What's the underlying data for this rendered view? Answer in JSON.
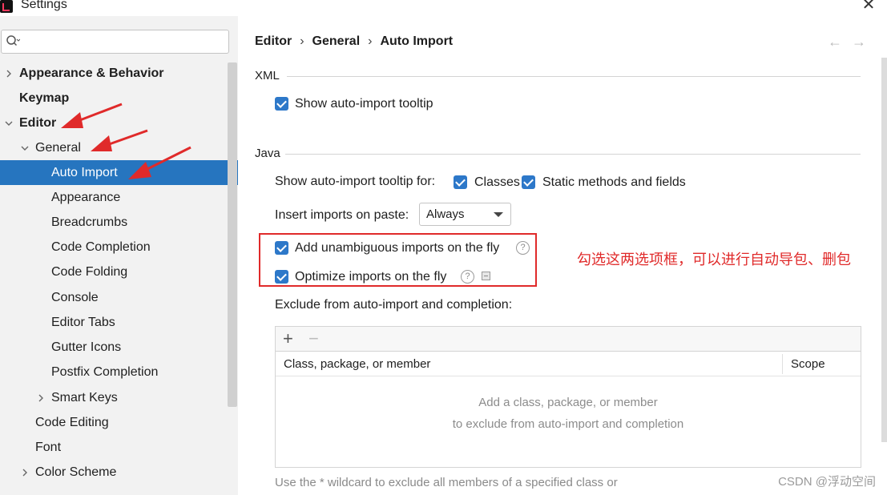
{
  "window": {
    "title": "Settings",
    "close_glyph": "✕",
    "app_icon": "intellij-idea-icon"
  },
  "search": {
    "placeholder": "",
    "value": ""
  },
  "sidebar": {
    "items": [
      {
        "label": "Appearance & Behavior",
        "bold": true,
        "chevron": "right"
      },
      {
        "label": "Keymap",
        "bold": true,
        "chevron": ""
      },
      {
        "label": "Editor",
        "bold": true,
        "chevron": "down"
      },
      {
        "label": "General",
        "bold": false,
        "chevron": "down"
      },
      {
        "label": "Auto Import",
        "bold": false,
        "selected": true
      },
      {
        "label": "Appearance"
      },
      {
        "label": "Breadcrumbs"
      },
      {
        "label": "Code Completion"
      },
      {
        "label": "Code Folding"
      },
      {
        "label": "Console"
      },
      {
        "label": "Editor Tabs"
      },
      {
        "label": "Gutter Icons"
      },
      {
        "label": "Postfix Completion"
      },
      {
        "label": "Smart Keys",
        "chevron": "right"
      },
      {
        "label": "Code Editing"
      },
      {
        "label": "Font"
      },
      {
        "label": "Color Scheme",
        "chevron": "right"
      }
    ]
  },
  "breadcrumb": {
    "items": [
      "Editor",
      "General",
      "Auto Import"
    ],
    "separator": "›"
  },
  "nav": {
    "back": "←",
    "forward": "→"
  },
  "xml": {
    "section": "XML",
    "show_tooltip": {
      "label": "Show auto-import tooltip",
      "checked": true
    }
  },
  "java": {
    "section": "Java",
    "tooltip_for": {
      "label": "Show auto-import tooltip for:",
      "classes": {
        "label": "Classes",
        "checked": true
      },
      "static": {
        "label": "Static methods and fields",
        "checked": true
      }
    },
    "insert_imports": {
      "label": "Insert imports on paste:",
      "value": "Always"
    },
    "add_unambiguous": {
      "label": "Add unambiguous imports on the fly",
      "checked": true
    },
    "optimize": {
      "label": "Optimize imports on the fly",
      "checked": true
    },
    "help_glyph": "?",
    "exclude": {
      "label": "Exclude from auto-import and completion:",
      "add_glyph": "+",
      "remove_glyph": "−",
      "columns": [
        "Class, package, or member",
        "Scope"
      ],
      "empty_line1": "Add a class, package, or member",
      "empty_line2": "to exclude from auto-import and completion"
    },
    "footnote": "Use the * wildcard to exclude all members of a specified class or"
  },
  "annotation": {
    "text": "勾选这两选项框，可以进行自动导包、删包",
    "color": "#e02a2a"
  },
  "watermark": "CSDN @浮动空间",
  "colors": {
    "selection": "#2675bf",
    "checkbox": "#2d78c9",
    "sidebar_bg": "#f2f2f2"
  }
}
